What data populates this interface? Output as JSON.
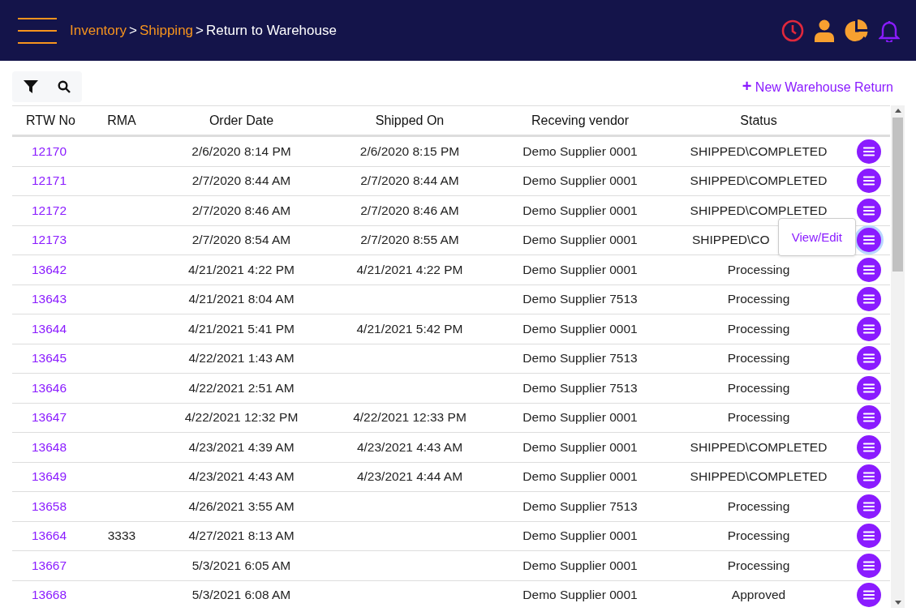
{
  "breadcrumb": [
    {
      "label": "Inventory",
      "link": true
    },
    {
      "label": "Shipping",
      "link": true
    },
    {
      "label": "Return to Warehouse",
      "link": false
    }
  ],
  "breadcrumb_separator": ">",
  "new_button": {
    "icon": "+",
    "label": "New Warehouse Return"
  },
  "table": {
    "columns": [
      "RTW No",
      "RMA",
      "Order Date",
      "Shipped On",
      "Receving vendor",
      "Status"
    ],
    "rows": [
      {
        "rtw": "12170",
        "rma": "",
        "order_date": "2/6/2020 8:14 PM",
        "shipped_on": "2/6/2020 8:15 PM",
        "vendor": "Demo Supplier 0001",
        "status": "SHIPPED\\COMPLETED"
      },
      {
        "rtw": "12171",
        "rma": "",
        "order_date": "2/7/2020 8:44 AM",
        "shipped_on": "2/7/2020 8:44 AM",
        "vendor": "Demo Supplier 0001",
        "status": "SHIPPED\\COMPLETED"
      },
      {
        "rtw": "12172",
        "rma": "",
        "order_date": "2/7/2020 8:46 AM",
        "shipped_on": "2/7/2020 8:46 AM",
        "vendor": "Demo Supplier 0001",
        "status": "SHIPPED\\COMPLETED"
      },
      {
        "rtw": "12173",
        "rma": "",
        "order_date": "2/7/2020 8:54 AM",
        "shipped_on": "2/7/2020 8:55 AM",
        "vendor": "Demo Supplier 0001",
        "status": "SHIPPED\\CO",
        "tooltip": "View/Edit"
      },
      {
        "rtw": "13642",
        "rma": "",
        "order_date": "4/21/2021 4:22 PM",
        "shipped_on": "4/21/2021 4:22 PM",
        "vendor": "Demo Supplier 0001",
        "status": "Processing"
      },
      {
        "rtw": "13643",
        "rma": "",
        "order_date": "4/21/2021 8:04 AM",
        "shipped_on": "",
        "vendor": "Demo Supplier 7513",
        "status": "Processing"
      },
      {
        "rtw": "13644",
        "rma": "",
        "order_date": "4/21/2021 5:41 PM",
        "shipped_on": "4/21/2021 5:42 PM",
        "vendor": "Demo Supplier 0001",
        "status": "Processing"
      },
      {
        "rtw": "13645",
        "rma": "",
        "order_date": "4/22/2021 1:43 AM",
        "shipped_on": "",
        "vendor": "Demo Supplier 7513",
        "status": "Processing"
      },
      {
        "rtw": "13646",
        "rma": "",
        "order_date": "4/22/2021 2:51 AM",
        "shipped_on": "",
        "vendor": "Demo Supplier 7513",
        "status": "Processing"
      },
      {
        "rtw": "13647",
        "rma": "",
        "order_date": "4/22/2021 12:32 PM",
        "shipped_on": "4/22/2021 12:33 PM",
        "vendor": "Demo Supplier 0001",
        "status": "Processing"
      },
      {
        "rtw": "13648",
        "rma": "",
        "order_date": "4/23/2021 4:39 AM",
        "shipped_on": "4/23/2021 4:43 AM",
        "vendor": "Demo Supplier 0001",
        "status": "SHIPPED\\COMPLETED"
      },
      {
        "rtw": "13649",
        "rma": "",
        "order_date": "4/23/2021 4:43 AM",
        "shipped_on": "4/23/2021 4:44 AM",
        "vendor": "Demo Supplier 0001",
        "status": "SHIPPED\\COMPLETED"
      },
      {
        "rtw": "13658",
        "rma": "",
        "order_date": "4/26/2021 3:55 AM",
        "shipped_on": "",
        "vendor": "Demo Supplier 7513",
        "status": "Processing"
      },
      {
        "rtw": "13664",
        "rma": "3333",
        "order_date": "4/27/2021 8:13 AM",
        "shipped_on": "",
        "vendor": "Demo Supplier 0001",
        "status": "Processing"
      },
      {
        "rtw": "13667",
        "rma": "",
        "order_date": "5/3/2021 6:05 AM",
        "shipped_on": "",
        "vendor": "Demo Supplier 0001",
        "status": "Processing"
      },
      {
        "rtw": "13668",
        "rma": "",
        "order_date": "5/3/2021 6:08 AM",
        "shipped_on": "",
        "vendor": "Demo Supplier 0001",
        "status": "Approved"
      }
    ]
  }
}
